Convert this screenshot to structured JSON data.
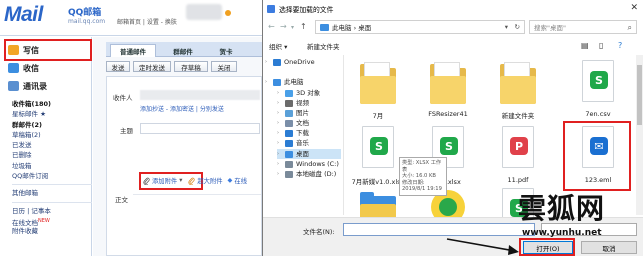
{
  "qqmail": {
    "logo": "Mail",
    "logo_sub": "QQ邮箱",
    "logo_url": "mail.qq.com",
    "top_links": "邮箱首页 | 设置 - 换肤",
    "sidebar": {
      "write": "写信",
      "inbox": "收信",
      "contacts": "通讯录",
      "folders": [
        {
          "label": "收件箱(180)",
          "bold": true
        },
        {
          "label": "星标邮件 ★",
          "bold": false
        },
        {
          "label": "群邮件(2)",
          "bold": true
        },
        {
          "label": "草稿箱(2)",
          "bold": false
        },
        {
          "label": "已发送",
          "bold": false
        },
        {
          "label": "已删除",
          "bold": false
        },
        {
          "label": "垃圾箱",
          "bold": false
        },
        {
          "label": "QQ邮件订阅",
          "bold": false
        }
      ],
      "other_mailboxes": "其他邮箱",
      "bottom_items": [
        {
          "label": "日历 | 记事本",
          "tag": ""
        },
        {
          "label": "在线文档",
          "tag": "NEW"
        },
        {
          "label": "附件收藏",
          "tag": ""
        }
      ]
    },
    "tabs": [
      "普通邮件",
      "群邮件",
      "贺卡"
    ],
    "toolbar": [
      "发送",
      "定时发送",
      "存草稿",
      "关闭"
    ],
    "recipient_label": "收件人",
    "recipient_links": "添加抄送 - 添加密送 | 分别发送",
    "subject_label": "主题",
    "attach_label": "添加附件",
    "super_attach_label": "超大附件",
    "online_label": "在线",
    "body_label": "正文"
  },
  "dialog": {
    "title": "选择要加载的文件",
    "close": "✕",
    "address": "此电脑 › 桌面",
    "search_placeholder": "搜索\"桌面\"",
    "organize": "组织 ▾",
    "new_folder": "新建文件夹",
    "tree": [
      {
        "label": "OneDrive",
        "icon_color": "#2b7cd3",
        "selected": false
      },
      {
        "label": "此电脑",
        "icon_color": "#3c8ee0",
        "selected": false
      },
      {
        "label": "3D 对象",
        "icon_color": "#4aa0e8",
        "selected": false
      },
      {
        "label": "视频",
        "icon_color": "#6b6b6b",
        "selected": false
      },
      {
        "label": "图片",
        "icon_color": "#5aa0d8",
        "selected": false
      },
      {
        "label": "文档",
        "icon_color": "#7a8ea8",
        "selected": false
      },
      {
        "label": "下载",
        "icon_color": "#2b7cd3",
        "selected": false
      },
      {
        "label": "音乐",
        "icon_color": "#2b7cd3",
        "selected": false
      },
      {
        "label": "桌面",
        "icon_color": "#3c8ee0",
        "selected": true
      },
      {
        "label": "Windows (C:)",
        "icon_color": "#7a8a9a",
        "selected": false
      },
      {
        "label": "本地磁盘 (D:)",
        "icon_color": "#7a8a9a",
        "selected": false
      }
    ],
    "files": [
      {
        "label": "7月",
        "kind": "folder"
      },
      {
        "label": "FSResizer41",
        "kind": "folder"
      },
      {
        "label": "新建文件夹",
        "kind": "folder"
      },
      {
        "label": "7en.csv",
        "kind": "green-doc",
        "glyph": "S"
      },
      {
        "label": "7月新媒v1.0.xlsx",
        "kind": "green-doc",
        "glyph": "S"
      },
      {
        "label": "8月.xlsx",
        "kind": "green-doc",
        "glyph": "S"
      },
      {
        "label": "11.pdf",
        "kind": "red-doc",
        "glyph": "P"
      },
      {
        "label": "123.eml",
        "kind": "eml",
        "glyph": "✉"
      },
      {
        "label": "",
        "kind": "folder-blue"
      },
      {
        "label": "",
        "kind": "app-green"
      },
      {
        "label": "",
        "kind": "green-doc",
        "glyph": "S"
      }
    ],
    "tooltip": "类型: XLSX 工作表\n大小: 16.0 KB\n修改日期: 2019/8/1 19:19",
    "filename_label": "文件名(N):",
    "filetype_value": "",
    "open_button": "打开(O)",
    "cancel_button": "取消"
  },
  "watermark": {
    "chars": "雲狐网",
    "url": "www.yunhu.net"
  },
  "colors": {
    "qq_blue": "#2b66c8",
    "highlight_red": "#e02020",
    "selection_blue": "#cce4f7",
    "excel_green": "#20a84a",
    "pdf_red": "#e0414a",
    "eml_blue": "#1a6fd1"
  }
}
